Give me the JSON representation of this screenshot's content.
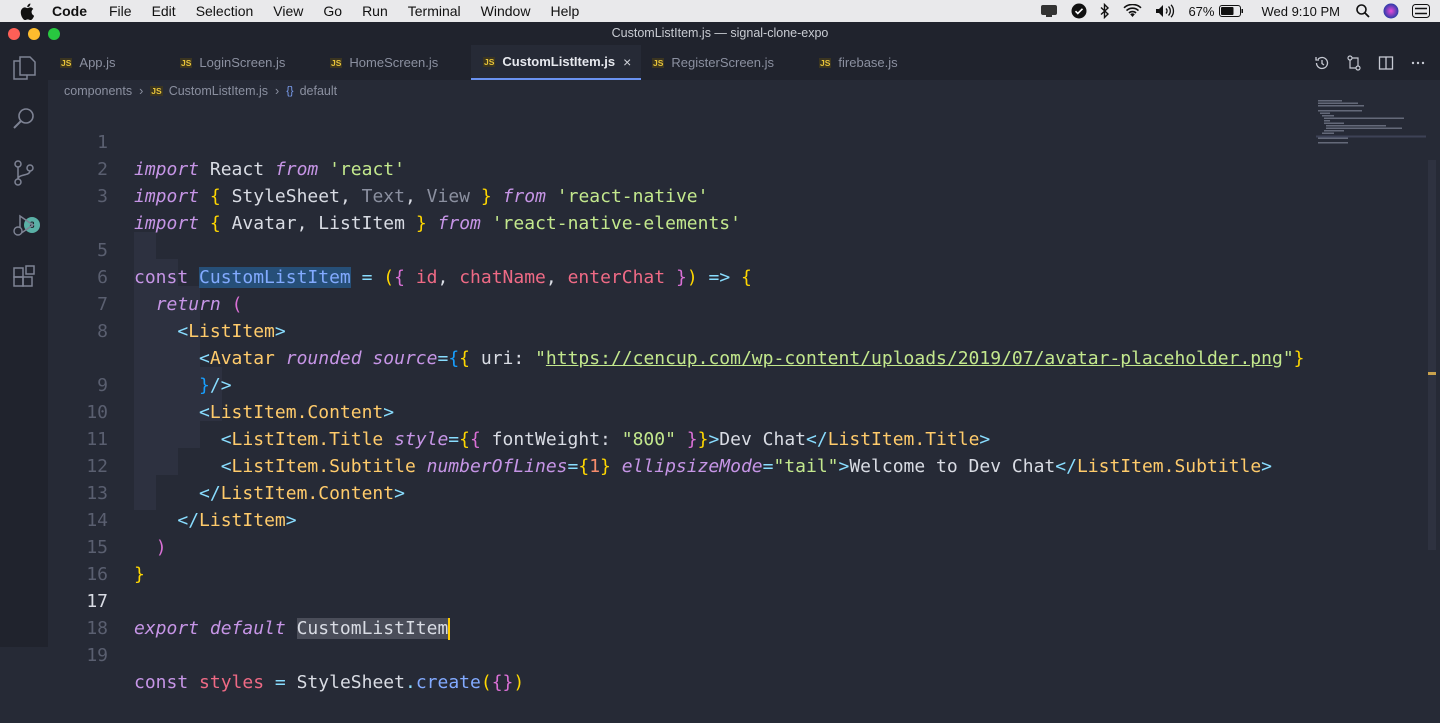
{
  "menubar": {
    "app_name": "Code",
    "items": [
      "File",
      "Edit",
      "Selection",
      "View",
      "Go",
      "Run",
      "Terminal",
      "Window",
      "Help"
    ],
    "battery": "67%",
    "clock": "Wed 9:10 PM"
  },
  "window": {
    "title": "CustomListItem.js — signal-clone-expo"
  },
  "activity": {
    "source_control_badge": "8"
  },
  "tabs": [
    {
      "label": "App.js",
      "icon": "JS"
    },
    {
      "label": "LoginScreen.js",
      "icon": "JS"
    },
    {
      "label": "HomeScreen.js",
      "icon": "JS"
    },
    {
      "label": "CustomListItem.js",
      "icon": "JS",
      "close": "×"
    },
    {
      "label": "RegisterScreen.js",
      "icon": "JS"
    },
    {
      "label": "firebase.js",
      "icon": "JS"
    }
  ],
  "breadcrumb": {
    "folder": "components",
    "file": "CustomListItem.js",
    "symbol": "default",
    "file_icon": "JS",
    "symbol_icon": "{}"
  },
  "editor": {
    "line_numbers": [
      "1",
      "2",
      "3",
      "",
      "5",
      "6",
      "7",
      "8",
      "",
      "9",
      "10",
      "11",
      "12",
      "13",
      "14",
      "15",
      "16",
      "17",
      "18",
      "19"
    ],
    "active_line": "17",
    "colors": {
      "background": "#262a36",
      "accent": "#6a92f0"
    }
  }
}
